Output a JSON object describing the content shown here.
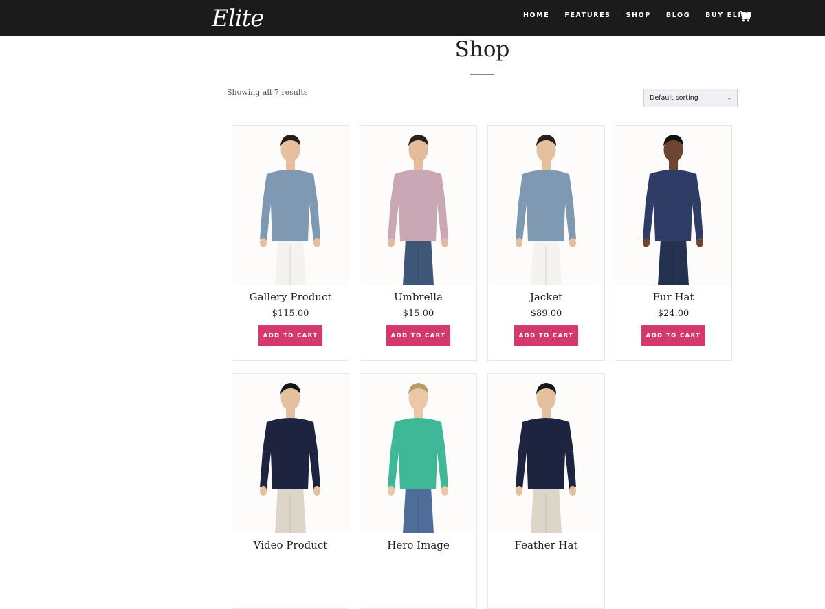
{
  "header": {
    "logo_text": "Elite",
    "nav": [
      "HOME",
      "FEATURES",
      "SHOP",
      "BLOG",
      "BUY ELITE"
    ]
  },
  "page": {
    "title": "Shop",
    "result_count": "Showing all 7 results",
    "sorting": "Default sorting"
  },
  "products": [
    {
      "name": "Gallery Product",
      "price": "$115.00",
      "button": "ADD TO CART",
      "shirt": "#7f99b3",
      "pants": "#f4f3ef",
      "skin": "#e6bf9f",
      "hair": "#2a1d15"
    },
    {
      "name": "Umbrella",
      "price": "$15.00",
      "button": "ADD TO CART",
      "shirt": "#c9a7b5",
      "pants": "#3e5678",
      "skin": "#e4bc9c",
      "hair": "#2b1e15"
    },
    {
      "name": "Jacket",
      "price": "$89.00",
      "button": "ADD TO CART",
      "shirt": "#7f99b3",
      "pants": "#f4f3ef",
      "skin": "#e6bf9f",
      "hair": "#2a1d15"
    },
    {
      "name": "Fur Hat",
      "price": "$24.00",
      "button": "ADD TO CART",
      "shirt": "#2f3c66",
      "pants": "#25324f",
      "skin": "#6e4530",
      "hair": "#111111"
    },
    {
      "name": "Video Product",
      "price": "",
      "button": "",
      "shirt": "#1e2340",
      "pants": "#dcd6c8",
      "skin": "#e3c09e",
      "hair": "#141414"
    },
    {
      "name": "Hero Image",
      "price": "",
      "button": "",
      "shirt": "#3eb897",
      "pants": "#4f6d99",
      "skin": "#ebc8a6",
      "hair": "#b89b68"
    },
    {
      "name": "Feather Hat",
      "price": "",
      "button": "",
      "shirt": "#1e2340",
      "pants": "#dcd6c8",
      "skin": "#e3c09e",
      "hair": "#141414"
    }
  ],
  "colors": {
    "navbar": "#1b1b1b",
    "button": "#d5386b"
  }
}
